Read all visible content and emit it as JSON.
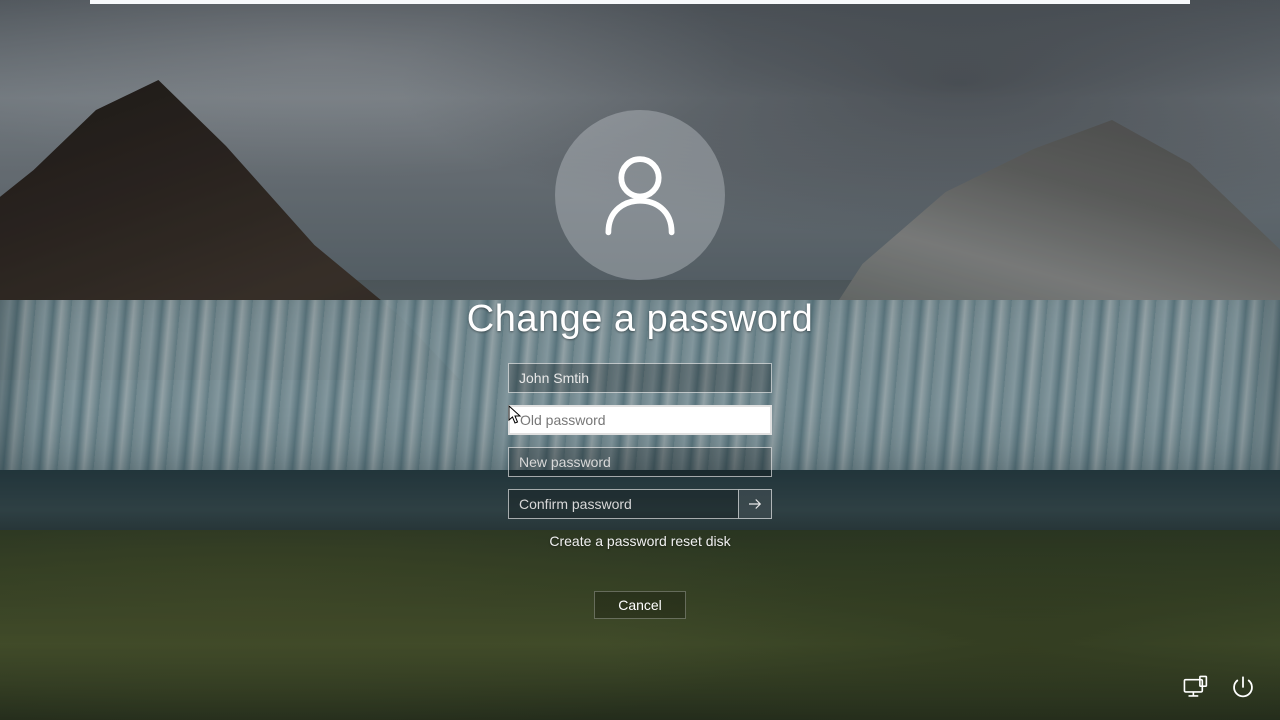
{
  "title": "Change a password",
  "username": "John Smtih",
  "fields": {
    "old_password_placeholder": "Old password",
    "new_password_placeholder": "New password",
    "confirm_password_placeholder": "Confirm password"
  },
  "link_reset_disk": "Create a password reset disk",
  "cancel_label": "Cancel",
  "icons": {
    "avatar": "user-icon",
    "submit": "arrow-right-icon",
    "ease_of_access": "ease-of-access-icon",
    "power": "power-icon"
  },
  "colors": {
    "text": "#ffffff",
    "field_bg_dim": "rgba(0,0,0,0.22)",
    "field_bg_active": "#ffffff"
  }
}
